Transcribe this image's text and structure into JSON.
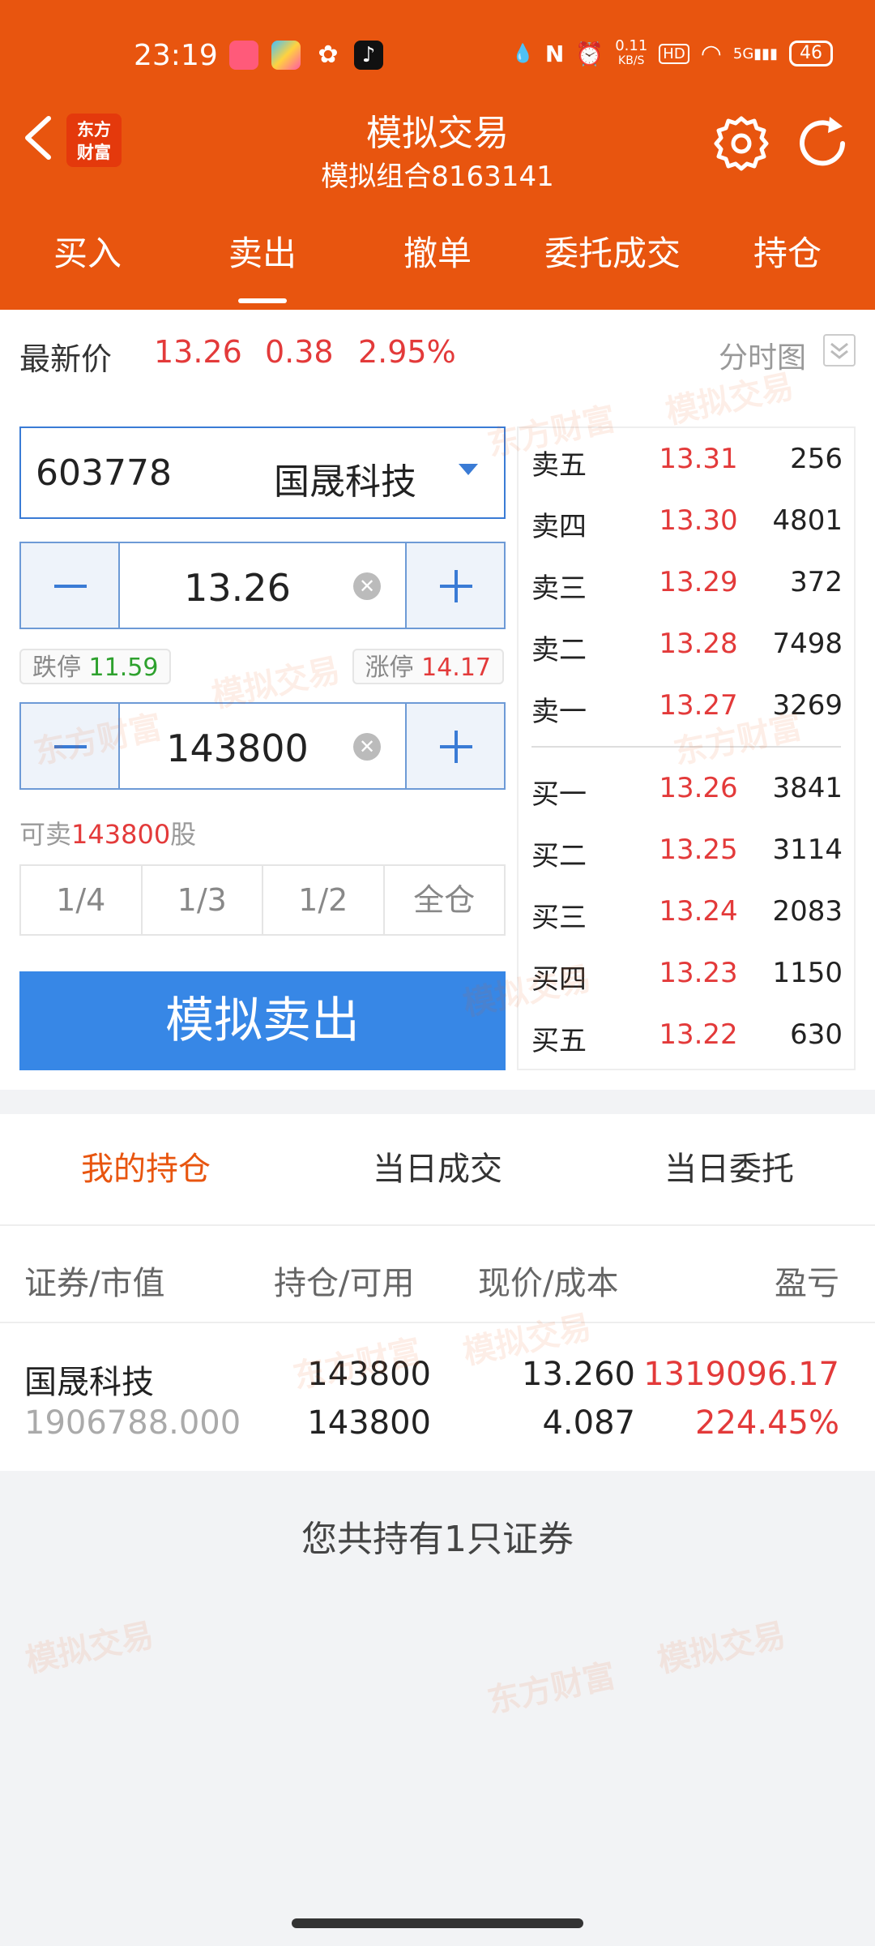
{
  "status_bar": {
    "time": "23:19",
    "net_speed": "0.11",
    "net_unit": "KB/S",
    "hd": "HD",
    "signal": "5G",
    "battery": "46"
  },
  "header": {
    "logo_line1": "东方",
    "logo_line2": "财富",
    "title": "模拟交易",
    "subtitle": "模拟组合8163141",
    "color": "#e8550f"
  },
  "tabs": [
    {
      "label": "买入"
    },
    {
      "label": "卖出"
    },
    {
      "label": "撤单"
    },
    {
      "label": "委托成交"
    },
    {
      "label": "持仓"
    }
  ],
  "quote": {
    "label": "最新价",
    "price": "13.26",
    "change": "0.38",
    "change_pct": "2.95%",
    "chart_link": "分时图"
  },
  "order": {
    "code": "603778",
    "name": "国晟科技",
    "price": "13.26",
    "limit_down_label": "跌停",
    "limit_down": "11.59",
    "limit_up_label": "涨停",
    "limit_up": "14.17",
    "quantity": "143800",
    "sellable_prefix": "可卖",
    "sellable": "143800",
    "sellable_suffix": "股",
    "ratios": [
      "1/4",
      "1/3",
      "1/2",
      "全仓"
    ],
    "submit": "模拟卖出"
  },
  "order_book": {
    "asks": [
      {
        "name": "卖五",
        "price": "13.31",
        "vol": "256"
      },
      {
        "name": "卖四",
        "price": "13.30",
        "vol": "4801"
      },
      {
        "name": "卖三",
        "price": "13.29",
        "vol": "372"
      },
      {
        "name": "卖二",
        "price": "13.28",
        "vol": "7498"
      },
      {
        "name": "卖一",
        "price": "13.27",
        "vol": "3269"
      }
    ],
    "bids": [
      {
        "name": "买一",
        "price": "13.26",
        "vol": "3841"
      },
      {
        "name": "买二",
        "price": "13.25",
        "vol": "3114"
      },
      {
        "name": "买三",
        "price": "13.24",
        "vol": "2083"
      },
      {
        "name": "买四",
        "price": "13.23",
        "vol": "1150"
      },
      {
        "name": "买五",
        "price": "13.22",
        "vol": "630"
      }
    ]
  },
  "positions": {
    "tabs": [
      "我的持仓",
      "当日成交",
      "当日委托"
    ],
    "columns": [
      "证券/市值",
      "持仓/可用",
      "现价/成本",
      "盈亏"
    ],
    "rows": [
      {
        "name": "国晟科技",
        "market_value": "1906788.000",
        "holding": "143800",
        "available": "143800",
        "price": "13.260",
        "cost": "4.087",
        "pnl": "1319096.17",
        "pnl_pct": "224.45%"
      }
    ],
    "summary": "您共持有1只证券"
  },
  "watermark": {
    "brand": "东方财富",
    "text": "模拟交易"
  }
}
